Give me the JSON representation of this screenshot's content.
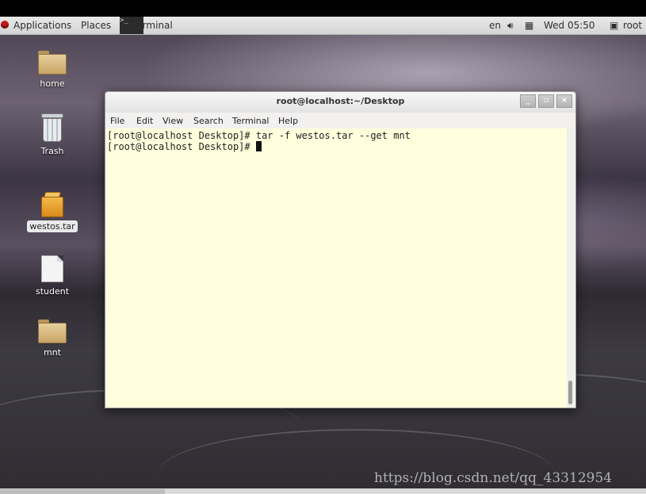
{
  "topbar": {
    "applications": "Applications",
    "places": "Places",
    "task_terminal": "Terminal",
    "language": "en",
    "volume_icon": "speaker-icon",
    "network_icon": "network-icon",
    "clock": "Wed 05:50",
    "user_icon": "user-icon",
    "user": "root"
  },
  "desktop_icons": [
    {
      "label": "home",
      "icon": "home-folder-icon"
    },
    {
      "label": "Trash",
      "icon": "trash-icon"
    },
    {
      "label": "westos.tar",
      "icon": "archive-icon"
    },
    {
      "label": "student",
      "icon": "file-icon"
    },
    {
      "label": "mnt",
      "icon": "folder-icon"
    }
  ],
  "terminal": {
    "title": "root@localhost:~/Desktop",
    "menu": [
      "File",
      "Edit",
      "View",
      "Search",
      "Terminal",
      "Help"
    ],
    "lines": [
      "[root@localhost Desktop]# tar -f westos.tar --get mnt",
      "[root@localhost Desktop]# "
    ],
    "buttons": {
      "minimize": "_",
      "maximize": "▫",
      "close": "×"
    },
    "background_color": "#ffffdd"
  },
  "watermark": "https://blog.csdn.net/qq_43312954"
}
